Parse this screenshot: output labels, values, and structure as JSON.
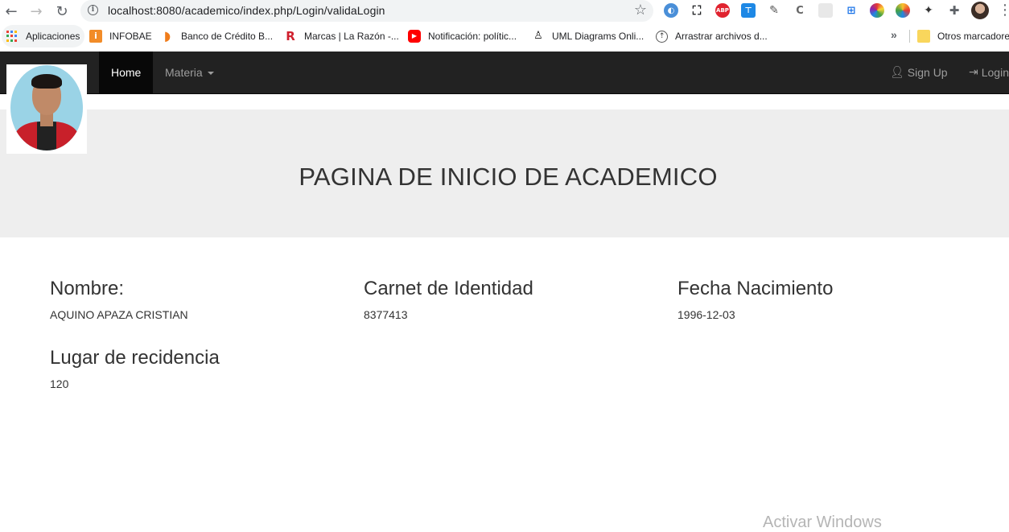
{
  "browser": {
    "url": "localhost:8080/academico/index.php/Login/validaLogin",
    "bookmarks": [
      {
        "label": "Aplicaciones",
        "icon": "apps-grid-icon"
      },
      {
        "label": "INFOBAE",
        "icon": "infobae-icon",
        "color": "#f28c28"
      },
      {
        "label": "Banco de Crédito B...",
        "icon": "bcp-icon",
        "color": "#f07c1a"
      },
      {
        "label": "Marcas | La Razón -...",
        "icon": "la-razon-icon",
        "color": "#d0202e"
      },
      {
        "label": "Notificación: polític...",
        "icon": "youtube-icon",
        "color": "#ff0000"
      },
      {
        "label": "UML Diagrams Onli...",
        "icon": "uml-icon",
        "color": "#1b1b1b"
      },
      {
        "label": "Arrastrar archivos d...",
        "icon": "upload-icon",
        "color": "#555555"
      }
    ],
    "other_bookmarks": "Otros marcadores",
    "overflow": "»"
  },
  "navbar": {
    "home": "Home",
    "materia": "Materia",
    "signup": "Sign Up",
    "login": "Login"
  },
  "jumbotron": {
    "title": "PAGINA DE INICIO DE ACADEMICO"
  },
  "profile": {
    "nombre_label": "Nombre:",
    "nombre_value": "AQUINO APAZA CRISTIAN",
    "ci_label": "Carnet de Identidad",
    "ci_value": "8377413",
    "fecha_label": "Fecha Nacimiento",
    "fecha_value": "1996-12-03",
    "lugar_label": "Lugar de recidencia",
    "lugar_value": "120"
  },
  "watermark": "Activar Windows",
  "colors": {
    "navbar_bg": "#222222",
    "navbar_active": "#080808",
    "jumbotron_bg": "#eeeeee"
  }
}
